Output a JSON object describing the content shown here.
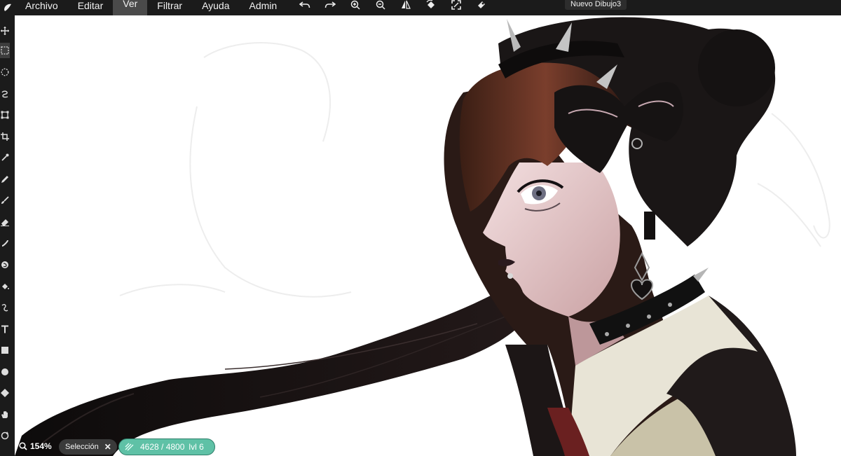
{
  "app": {
    "document_title": "Nuevo Dibujo3"
  },
  "menu": {
    "items": [
      {
        "label": "Archivo"
      },
      {
        "label": "Editar"
      },
      {
        "label": "Ver",
        "active": true
      },
      {
        "label": "Filtrar"
      },
      {
        "label": "Ayuda"
      },
      {
        "label": "Admin"
      }
    ]
  },
  "toolbar_icons": [
    "undo-icon",
    "redo-icon",
    "zoom-in-icon",
    "zoom-out-icon",
    "flip-icon",
    "rotate-icon",
    "fullscreen-icon",
    "settings-icon"
  ],
  "left_tools": [
    "move-icon",
    "marquee-select-icon",
    "lasso-select-icon",
    "freeform-select-icon",
    "transform-icon",
    "crop-icon",
    "eyedropper-icon",
    "pencil-icon",
    "brush-icon",
    "eraser-icon",
    "smudge-icon",
    "blend-icon",
    "fill-icon",
    "gradient-icon",
    "text-icon",
    "rectangle-icon",
    "ellipse-icon",
    "shape-icon",
    "hand-icon",
    "rotate-view-icon"
  ],
  "status": {
    "zoom": "154%",
    "selection_label": "Selección",
    "layer_count": "4628 / 4800",
    "layer_level": "lvl 6"
  },
  "colors": {
    "accent": "#5fc1a6",
    "menubar": "#1b1b1b",
    "canvas": "#ffffff"
  }
}
